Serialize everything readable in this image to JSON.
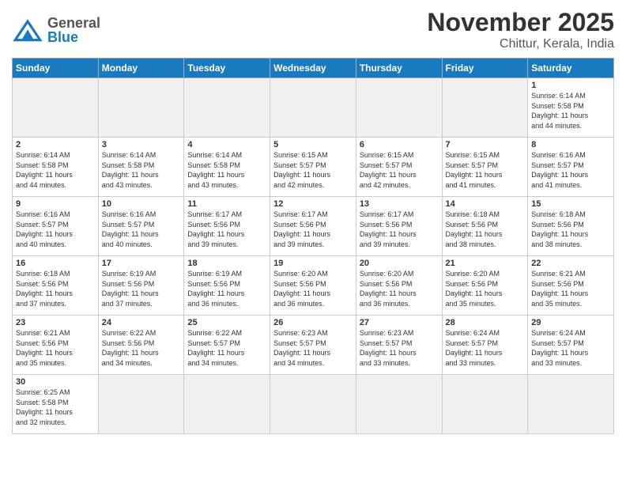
{
  "logo": {
    "general": "General",
    "blue": "Blue"
  },
  "title": "November 2025",
  "subtitle": "Chittur, Kerala, India",
  "days": [
    "Sunday",
    "Monday",
    "Tuesday",
    "Wednesday",
    "Thursday",
    "Friday",
    "Saturday"
  ],
  "cells": [
    {
      "day": "",
      "info": ""
    },
    {
      "day": "",
      "info": ""
    },
    {
      "day": "",
      "info": ""
    },
    {
      "day": "",
      "info": ""
    },
    {
      "day": "",
      "info": ""
    },
    {
      "day": "",
      "info": ""
    },
    {
      "day": "1",
      "info": "Sunrise: 6:14 AM\nSunset: 5:58 PM\nDaylight: 11 hours\nand 44 minutes."
    },
    {
      "day": "2",
      "info": "Sunrise: 6:14 AM\nSunset: 5:58 PM\nDaylight: 11 hours\nand 44 minutes."
    },
    {
      "day": "3",
      "info": "Sunrise: 6:14 AM\nSunset: 5:58 PM\nDaylight: 11 hours\nand 43 minutes."
    },
    {
      "day": "4",
      "info": "Sunrise: 6:14 AM\nSunset: 5:58 PM\nDaylight: 11 hours\nand 43 minutes."
    },
    {
      "day": "5",
      "info": "Sunrise: 6:15 AM\nSunset: 5:57 PM\nDaylight: 11 hours\nand 42 minutes."
    },
    {
      "day": "6",
      "info": "Sunrise: 6:15 AM\nSunset: 5:57 PM\nDaylight: 11 hours\nand 42 minutes."
    },
    {
      "day": "7",
      "info": "Sunrise: 6:15 AM\nSunset: 5:57 PM\nDaylight: 11 hours\nand 41 minutes."
    },
    {
      "day": "8",
      "info": "Sunrise: 6:16 AM\nSunset: 5:57 PM\nDaylight: 11 hours\nand 41 minutes."
    },
    {
      "day": "9",
      "info": "Sunrise: 6:16 AM\nSunset: 5:57 PM\nDaylight: 11 hours\nand 40 minutes."
    },
    {
      "day": "10",
      "info": "Sunrise: 6:16 AM\nSunset: 5:57 PM\nDaylight: 11 hours\nand 40 minutes."
    },
    {
      "day": "11",
      "info": "Sunrise: 6:17 AM\nSunset: 5:56 PM\nDaylight: 11 hours\nand 39 minutes."
    },
    {
      "day": "12",
      "info": "Sunrise: 6:17 AM\nSunset: 5:56 PM\nDaylight: 11 hours\nand 39 minutes."
    },
    {
      "day": "13",
      "info": "Sunrise: 6:17 AM\nSunset: 5:56 PM\nDaylight: 11 hours\nand 39 minutes."
    },
    {
      "day": "14",
      "info": "Sunrise: 6:18 AM\nSunset: 5:56 PM\nDaylight: 11 hours\nand 38 minutes."
    },
    {
      "day": "15",
      "info": "Sunrise: 6:18 AM\nSunset: 5:56 PM\nDaylight: 11 hours\nand 38 minutes."
    },
    {
      "day": "16",
      "info": "Sunrise: 6:18 AM\nSunset: 5:56 PM\nDaylight: 11 hours\nand 37 minutes."
    },
    {
      "day": "17",
      "info": "Sunrise: 6:19 AM\nSunset: 5:56 PM\nDaylight: 11 hours\nand 37 minutes."
    },
    {
      "day": "18",
      "info": "Sunrise: 6:19 AM\nSunset: 5:56 PM\nDaylight: 11 hours\nand 36 minutes."
    },
    {
      "day": "19",
      "info": "Sunrise: 6:20 AM\nSunset: 5:56 PM\nDaylight: 11 hours\nand 36 minutes."
    },
    {
      "day": "20",
      "info": "Sunrise: 6:20 AM\nSunset: 5:56 PM\nDaylight: 11 hours\nand 36 minutes."
    },
    {
      "day": "21",
      "info": "Sunrise: 6:20 AM\nSunset: 5:56 PM\nDaylight: 11 hours\nand 35 minutes."
    },
    {
      "day": "22",
      "info": "Sunrise: 6:21 AM\nSunset: 5:56 PM\nDaylight: 11 hours\nand 35 minutes."
    },
    {
      "day": "23",
      "info": "Sunrise: 6:21 AM\nSunset: 5:56 PM\nDaylight: 11 hours\nand 35 minutes."
    },
    {
      "day": "24",
      "info": "Sunrise: 6:22 AM\nSunset: 5:56 PM\nDaylight: 11 hours\nand 34 minutes."
    },
    {
      "day": "25",
      "info": "Sunrise: 6:22 AM\nSunset: 5:57 PM\nDaylight: 11 hours\nand 34 minutes."
    },
    {
      "day": "26",
      "info": "Sunrise: 6:23 AM\nSunset: 5:57 PM\nDaylight: 11 hours\nand 34 minutes."
    },
    {
      "day": "27",
      "info": "Sunrise: 6:23 AM\nSunset: 5:57 PM\nDaylight: 11 hours\nand 33 minutes."
    },
    {
      "day": "28",
      "info": "Sunrise: 6:24 AM\nSunset: 5:57 PM\nDaylight: 11 hours\nand 33 minutes."
    },
    {
      "day": "29",
      "info": "Sunrise: 6:24 AM\nSunset: 5:57 PM\nDaylight: 11 hours\nand 33 minutes."
    },
    {
      "day": "30",
      "info": "Sunrise: 6:25 AM\nSunset: 5:58 PM\nDaylight: 11 hours\nand 32 minutes."
    },
    {
      "day": "",
      "info": ""
    },
    {
      "day": "",
      "info": ""
    },
    {
      "day": "",
      "info": ""
    },
    {
      "day": "",
      "info": ""
    },
    {
      "day": "",
      "info": ""
    },
    {
      "day": "",
      "info": ""
    }
  ]
}
